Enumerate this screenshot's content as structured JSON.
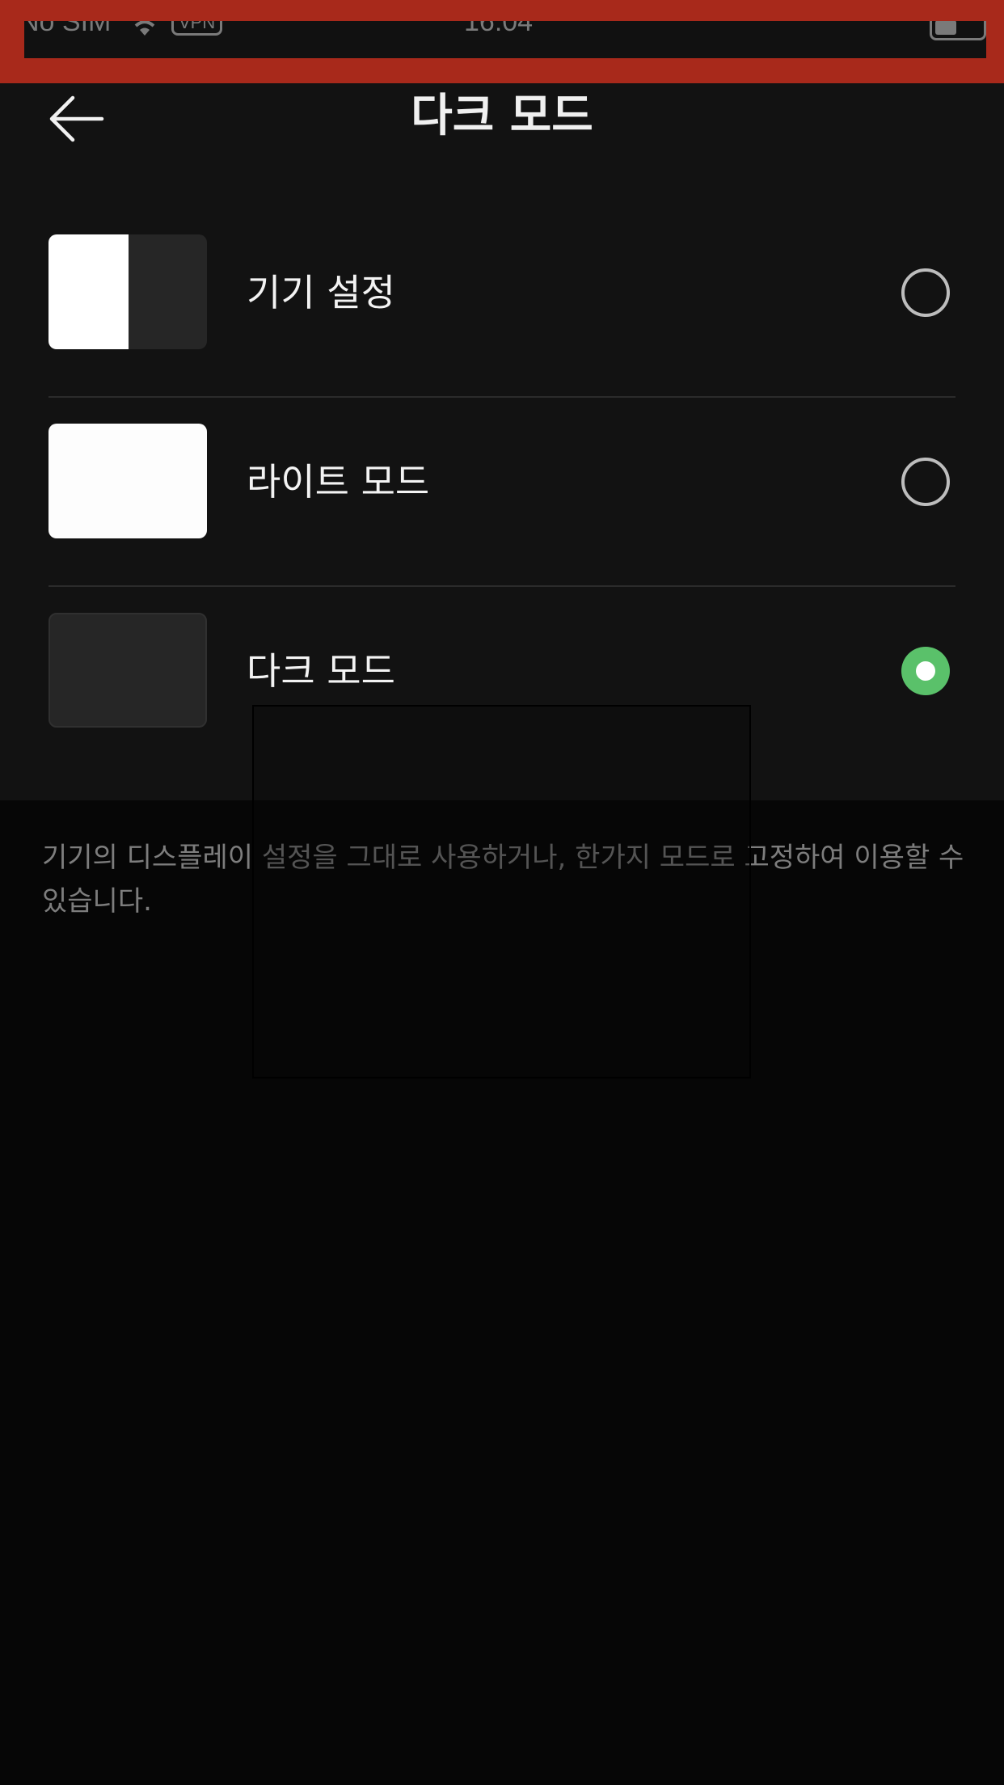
{
  "status_bar": {
    "carrier": "No SIM",
    "vpn": "VPN",
    "time": "16:04"
  },
  "header": {
    "title": "다크 모드"
  },
  "options": [
    {
      "label": "기기 설정",
      "selected": false,
      "thumbnail": "split-light-dark"
    },
    {
      "label": "라이트 모드",
      "selected": false,
      "thumbnail": "light"
    },
    {
      "label": "다크 모드",
      "selected": true,
      "thumbnail": "dark"
    }
  ],
  "description": "기기의 디스플레이 설정을 그대로 사용하거나, 한가지 모드로 고정하여 이용할 수 있습니다.",
  "colors": {
    "accent": "#5ac16a",
    "status_bar_highlight": "#a8291b",
    "background": "#121212"
  }
}
